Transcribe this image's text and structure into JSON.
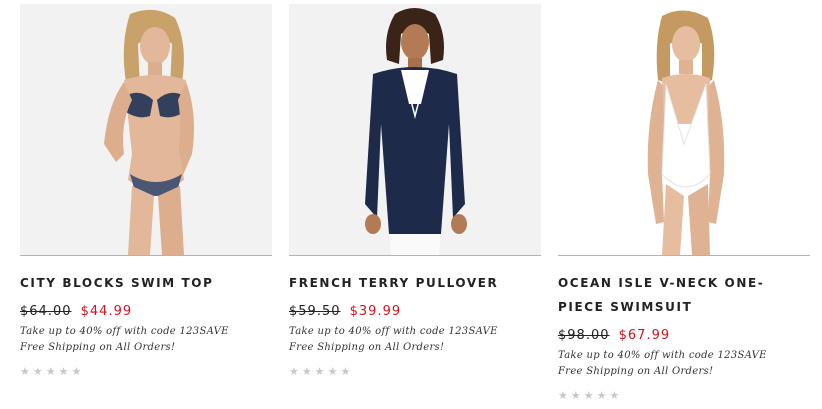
{
  "products": [
    {
      "title": "CITY BLOCKS SWIM TOP",
      "old_price": "$64.00",
      "new_price": "$44.99",
      "promo": "Take up to 40% off with code 123SAVE",
      "shipping": "Free Shipping on All Orders!",
      "rating": 0,
      "stars": "★★★★★",
      "image": "swim-top-model-image"
    },
    {
      "title": "FRENCH TERRY PULLOVER",
      "old_price": "$59.50",
      "new_price": "$39.99",
      "promo": "Take up to 40% off with code 123SAVE",
      "shipping": "Free Shipping on All Orders!",
      "rating": 0,
      "stars": "★★★★★",
      "image": "pullover-model-image"
    },
    {
      "title": "OCEAN ISLE V-NECK ONE-PIECE SWIMSUIT",
      "old_price": "$98.00",
      "new_price": "$67.99",
      "promo": "Take up to 40% off with code 123SAVE",
      "shipping": "Free Shipping on All Orders!",
      "rating": 0,
      "stars": "★★★★★",
      "image": "swimsuit-model-image"
    }
  ],
  "colors": {
    "sale_price": "#d8101f",
    "star_empty": "#c8c8c8",
    "image_bg": "#f2f2f2"
  }
}
